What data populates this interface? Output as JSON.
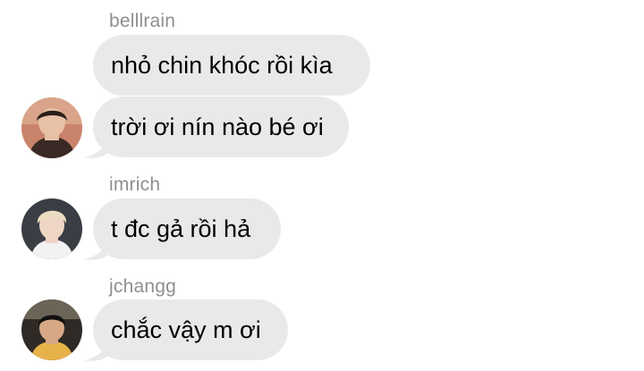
{
  "messages": [
    {
      "sender": "belllrain",
      "text": "nhỏ chin khóc rồi kìa"
    },
    {
      "sender": "",
      "text": "trời ơi nín nào bé ơi"
    },
    {
      "sender": "imrich",
      "text": "t đc gả rồi hả"
    },
    {
      "sender": "jchangg",
      "text": "chắc vậy m ơi"
    }
  ],
  "colors": {
    "bubble": "#e9e9eb",
    "sender_name": "#8e8e93",
    "text": "#000000",
    "background": "#ffffff"
  },
  "avatars": [
    {
      "name": "avatar-belllrain",
      "icon": "profile-photo"
    },
    {
      "name": "avatar-imrich",
      "icon": "profile-photo"
    },
    {
      "name": "avatar-jchangg",
      "icon": "profile-photo"
    }
  ]
}
